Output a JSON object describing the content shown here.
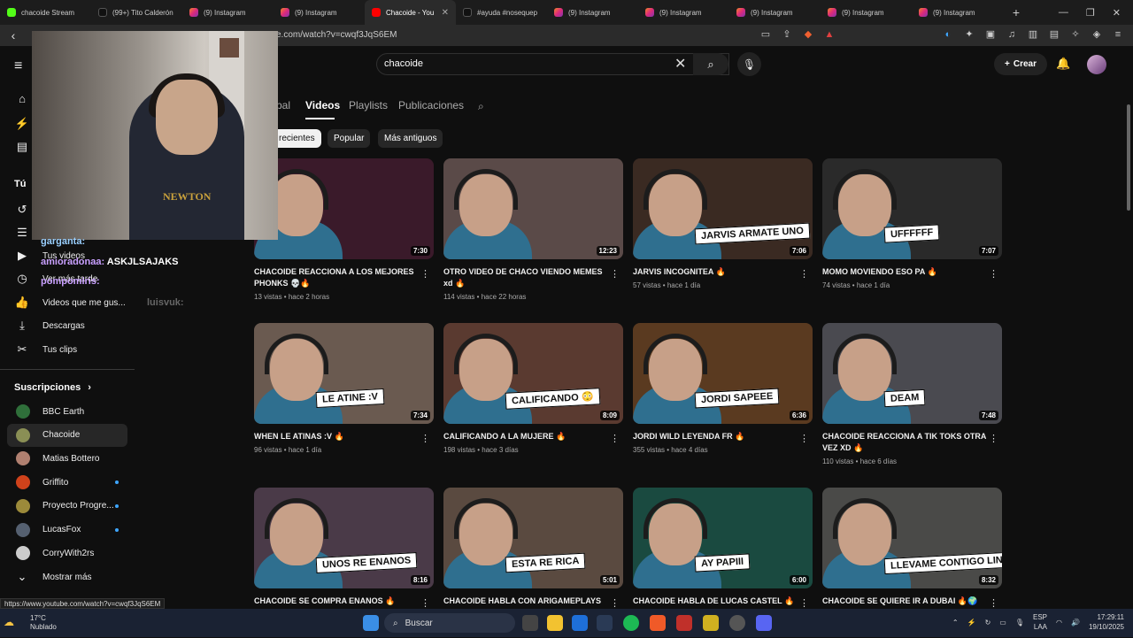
{
  "browser": {
    "tabs": [
      {
        "label": "chacoide Stream",
        "icon": "kick"
      },
      {
        "label": "(99+) Tito Calderón",
        "icon": "tiktok"
      },
      {
        "label": "(9) Instagram",
        "icon": "instagram"
      },
      {
        "label": "(9) Instagram",
        "icon": "instagram"
      },
      {
        "label": "Chacoide - You",
        "icon": "youtube",
        "active": true
      },
      {
        "label": "#ayuda #nosequep",
        "icon": "tiktok"
      },
      {
        "label": "(9) Instagram",
        "icon": "instagram"
      },
      {
        "label": "(9) Instagram",
        "icon": "instagram"
      },
      {
        "label": "(9) Instagram",
        "icon": "instagram"
      },
      {
        "label": "(9) Instagram",
        "icon": "instagram"
      },
      {
        "label": "(9) Instagram",
        "icon": "instagram"
      }
    ],
    "new_tab": "+",
    "url": "e.com/watch?v=cwqf3JqS6EM",
    "status_url": "https://www.youtube.com/watch?v=cwqf3JqS6EM"
  },
  "stream_chat": [
    {
      "user": "garganta:",
      "message": "",
      "color": "#9ad0ff"
    },
    {
      "user": "amioradonaa:",
      "message": "ASKJLSAJAKS",
      "color": "#c9a0ff"
    },
    {
      "user": "pompomiris:",
      "message": "",
      "color": "#c9a0ff"
    },
    {
      "user": "",
      "message": "luisvuk:",
      "color": "#777777"
    }
  ],
  "youtube": {
    "search": {
      "query": "chacoide"
    },
    "create_label": "Crear",
    "channel_tabs": [
      "pal",
      "Videos",
      "Playlists",
      "Publicaciones"
    ],
    "active_tab": "Videos",
    "chips": [
      "recientes",
      "Popular",
      "Más antiguos"
    ],
    "sidebar": {
      "you_header": "Tú",
      "items": [
        "Tus videos",
        "Ver más tarde",
        "Videos que me gus...",
        "Descargas",
        "Tus clips"
      ],
      "subs_header": "Suscripciones",
      "subs": [
        {
          "name": "BBC Earth",
          "color": "#2f6f3a",
          "live": false
        },
        {
          "name": "Chacoide",
          "color": "#8a8f55",
          "selected": true,
          "live": false
        },
        {
          "name": "Matias Bottero",
          "color": "#b08070",
          "live": false
        },
        {
          "name": "Griffito",
          "color": "#d0421b",
          "live": true
        },
        {
          "name": "Proyecto Progre...",
          "color": "#9c8a3a",
          "live": true
        },
        {
          "name": "LucasFox",
          "color": "#556070",
          "live": true
        },
        {
          "name": "CorryWith2rs",
          "color": "#cccccc",
          "live": false
        }
      ],
      "show_more": "Mostrar más"
    },
    "videos": [
      {
        "title": "CHACOIDE REACCIONA A LOS MEJORES PHONKS 💀🔥",
        "views": "13 vistas",
        "age": "hace 2 horas",
        "duration": "7:30",
        "caption": "",
        "bg": "#3a1a2a"
      },
      {
        "title": "OTRO VIDEO DE CHACO VIENDO MEMES xd 🔥",
        "views": "114 vistas",
        "age": "hace 22 horas",
        "duration": "12:23",
        "caption": "",
        "bg": "#5a4a48"
      },
      {
        "title": "JARVIS INCOGNITEA 🔥",
        "views": "57 vistas",
        "age": "hace 1 día",
        "duration": "7:06",
        "caption": "JARVIS ARMATE UNO",
        "bg": "#3a2a22"
      },
      {
        "title": "MOMO MOVIENDO ESO PA 🔥",
        "views": "74 vistas",
        "age": "hace 1 día",
        "duration": "7:07",
        "caption": "UFFFFFF",
        "bg": "#2a2a2a"
      },
      {
        "title": "WHEN LE ATINAS :V 🔥",
        "views": "96 vistas",
        "age": "hace 1 día",
        "duration": "7:34",
        "caption": "LE ATINE :V",
        "bg": "#6a5a50"
      },
      {
        "title": "CALIFICANDO A LA MUJERE 🔥",
        "views": "198 vistas",
        "age": "hace 3 días",
        "duration": "8:09",
        "caption": "CALIFICANDO 😳",
        "bg": "#5a3a30"
      },
      {
        "title": "JORDI WILD LEYENDA FR 🔥",
        "views": "355 vistas",
        "age": "hace 4 días",
        "duration": "6:36",
        "caption": "JORDI SAPEEE",
        "bg": "#5a3a20"
      },
      {
        "title": "CHACOIDE REACCIONA A TIK TOKS OTRA VEZ XD 🔥",
        "views": "110 vistas",
        "age": "hace 6 días",
        "duration": "7:48",
        "caption": "DEAM",
        "bg": "#4a4a50"
      },
      {
        "title": "CHACOIDE SE COMPRA ENANOS 🔥",
        "views": "",
        "age": "",
        "duration": "8:16",
        "caption": "UNOS RE ENANOS",
        "bg": "#4a3a48"
      },
      {
        "title": "CHACOIDE HABLA CON ARIGAMEPLAYS",
        "views": "",
        "age": "",
        "duration": "5:01",
        "caption": "ESTA RE RICA",
        "bg": "#5a4a40"
      },
      {
        "title": "CHACOIDE HABLA DE LUCAS CASTEL 🔥",
        "views": "",
        "age": "",
        "duration": "6:00",
        "caption": "AY PAPIII",
        "bg": "#1a4a40"
      },
      {
        "title": "CHACOIDE SE QUIERE IR A DUBAI 🔥🌍",
        "views": "",
        "age": "",
        "duration": "8:32",
        "caption": "LLEVAME CONTIGO LINDO",
        "bg": "#4a4a48"
      }
    ]
  },
  "taskbar": {
    "temp": "17°C",
    "weather": "Nublado",
    "search": "Buscar",
    "lang": "ESP",
    "lang2": "LAA",
    "time": "17:29:11",
    "date": "19/10/2025"
  },
  "colors": {
    "accent": "#ff0000",
    "bg": "#0f0f0f",
    "live_dot": "#3ea6ff"
  }
}
